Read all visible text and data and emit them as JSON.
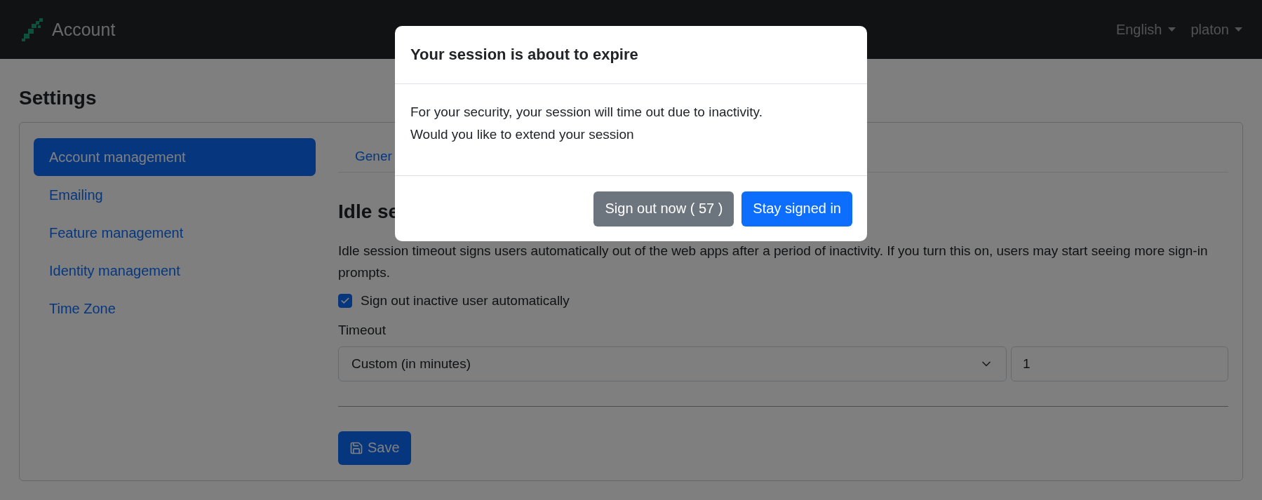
{
  "navbar": {
    "brand": "Account",
    "menus": [
      {
        "label": "English"
      },
      {
        "label": "platon"
      }
    ]
  },
  "page_title": "Settings",
  "sidebar": {
    "items": [
      {
        "label": "Account management",
        "selected": true
      },
      {
        "label": "Emailing",
        "selected": false
      },
      {
        "label": "Feature management",
        "selected": false
      },
      {
        "label": "Identity management",
        "selected": false
      },
      {
        "label": "Time Zone",
        "selected": false
      }
    ]
  },
  "tabs": [
    {
      "label": "Gener"
    }
  ],
  "section": {
    "heading": "Idle se",
    "description": "Idle session timeout signs users automatically out of the web apps after a period of inactivity. If you turn this on, users may start seeing more sign-in prompts.",
    "checkbox": {
      "label": "Sign out inactive user automatically",
      "checked": true
    },
    "timeout_label": "Timeout",
    "timeout_select": {
      "value": "Custom (in minutes)"
    },
    "timeout_input": {
      "value": "1"
    },
    "save_button": "Save"
  },
  "modal": {
    "title": "Your session is about to expire",
    "body": [
      "For your security, your session will time out due to inactivity.",
      "Would you like to extend your session"
    ],
    "buttons": [
      {
        "label": "Sign out now ( 57 )",
        "kind": "secondary"
      },
      {
        "label": "Stay signed in",
        "kind": "primary"
      }
    ]
  }
}
